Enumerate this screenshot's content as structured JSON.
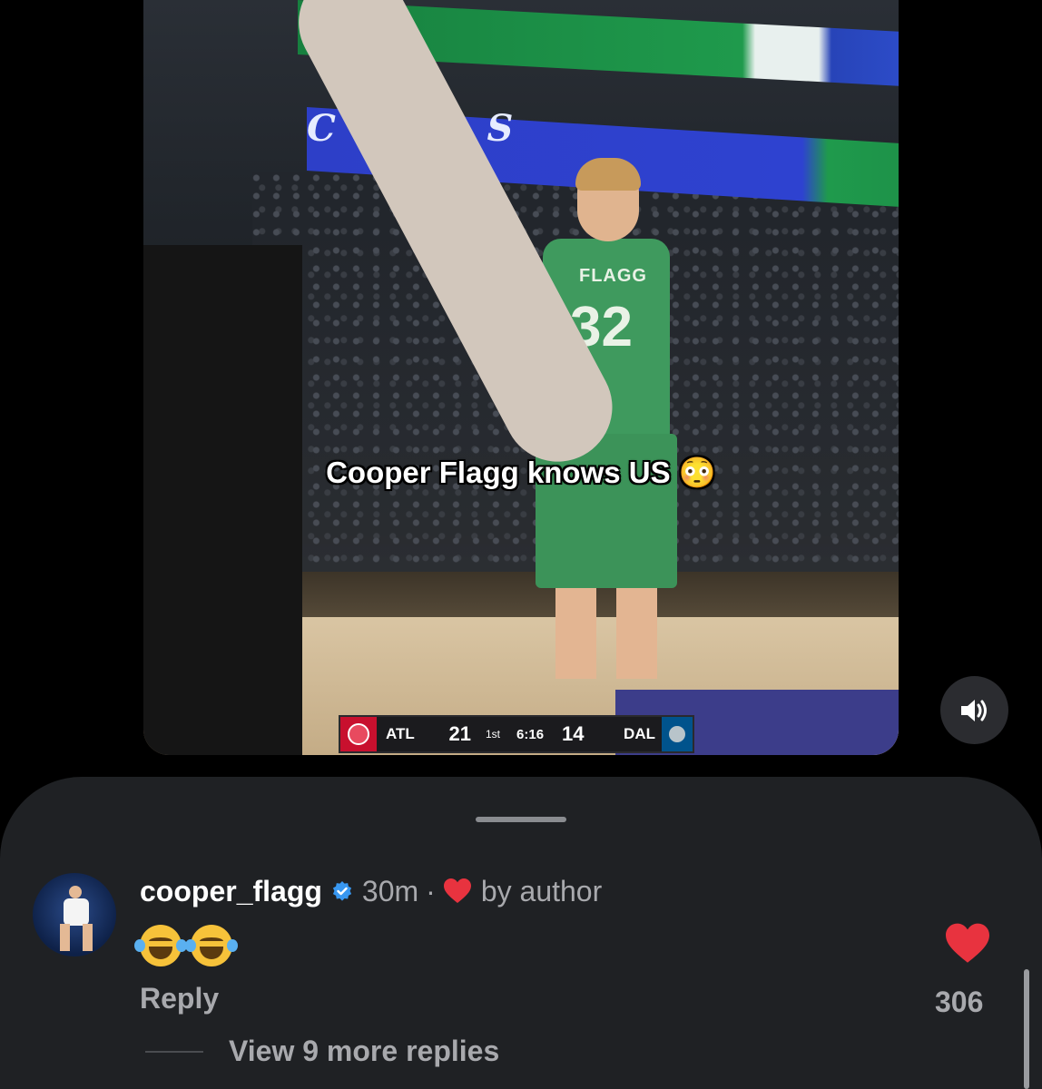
{
  "video": {
    "caption": "Cooper Flagg knows US 😳",
    "jersey_name": "FLAGG",
    "jersey_number": "32",
    "arena_text": "C K S",
    "scorebug": {
      "away_team": "ATL",
      "away_score": "21",
      "period": "1st",
      "clock": "6:16",
      "home_score": "14",
      "home_team": "DAL"
    },
    "volume_icon": "speaker-on-icon"
  },
  "comment": {
    "username": "cooper_flagg",
    "verified": true,
    "time": "30m",
    "separator": "·",
    "liked_by_author_label": "by author",
    "body_emoji": [
      "face-with-tears-of-joy",
      "face-with-tears-of-joy"
    ],
    "reply_label": "Reply",
    "like_count": "306",
    "view_replies_label": "View 9 more replies"
  },
  "colors": {
    "background": "#000000",
    "sheet": "#1f2124",
    "heart": "#e8333f",
    "verified": "#3897f0",
    "secondary_text": "#a8a9ad"
  }
}
